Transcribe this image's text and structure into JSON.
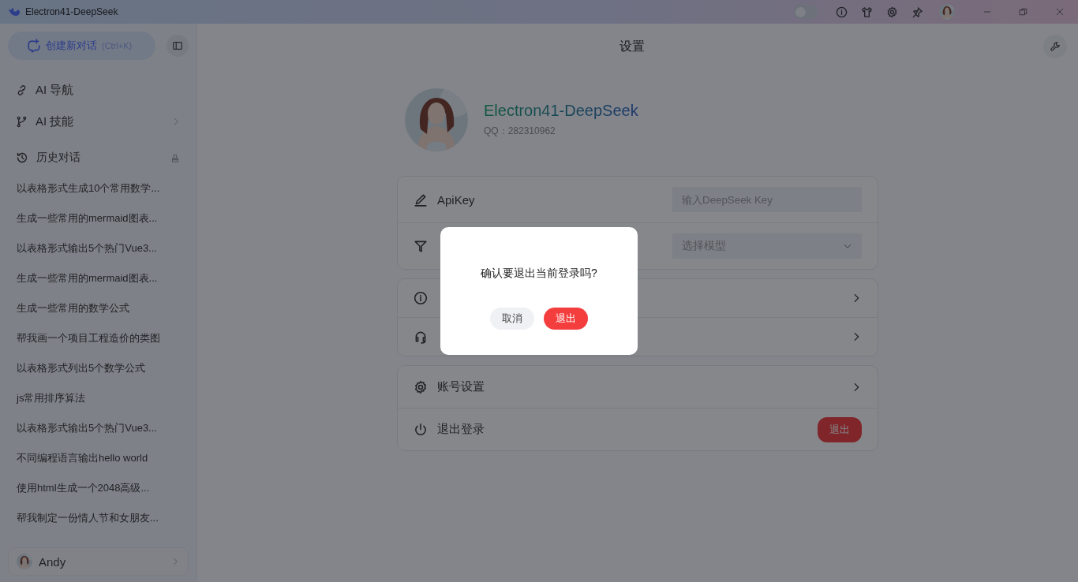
{
  "titlebar": {
    "title": "Electron41-DeepSeek",
    "theme_switch": {
      "on": false
    }
  },
  "sidebar": {
    "new_chat": {
      "label": "创建新对话",
      "shortcut": "(Ctrl+K)"
    },
    "nav": [
      {
        "label": "AI 导航",
        "kind": "link"
      },
      {
        "label": "AI 技能",
        "kind": "expand"
      }
    ],
    "history": {
      "title": "历史对话",
      "items": [
        "以表格形式生成10个常用数学...",
        "生成一些常用的mermaid图表...",
        "以表格形式输出5个热门Vue3...",
        "生成一些常用的mermaid图表...",
        "生成一些常用的数学公式",
        "帮我画一个项目工程造价的类图",
        "以表格形式列出5个数学公式",
        "js常用排序算法",
        "以表格形式输出5个热门Vue3...",
        "不同编程语言输出hello world",
        "使用html生成一个2048高级...",
        "帮我制定一份情人节和女朋友..."
      ]
    },
    "user": {
      "name": "Andy"
    }
  },
  "main": {
    "title": "设置",
    "profile": {
      "name": "Electron41-DeepSeek",
      "qq": "QQ：282310962"
    },
    "groups": [
      {
        "rows": [
          {
            "kind": "input",
            "label": "ApiKey",
            "placeholder": "输入DeepSeek Key"
          },
          {
            "kind": "select",
            "placeholder": "选择模型"
          }
        ]
      },
      {
        "rows": [
          {
            "kind": "link"
          },
          {
            "kind": "link"
          }
        ]
      },
      {
        "rows": [
          {
            "kind": "link",
            "label": "账号设置"
          },
          {
            "kind": "button",
            "label": "退出登录",
            "button": "退出"
          }
        ]
      }
    ]
  },
  "dialog": {
    "message": "确认要退出当前登录吗?",
    "buttons": [
      {
        "label": "取消",
        "kind": "secondary"
      },
      {
        "label": "退出",
        "kind": "danger"
      }
    ]
  }
}
